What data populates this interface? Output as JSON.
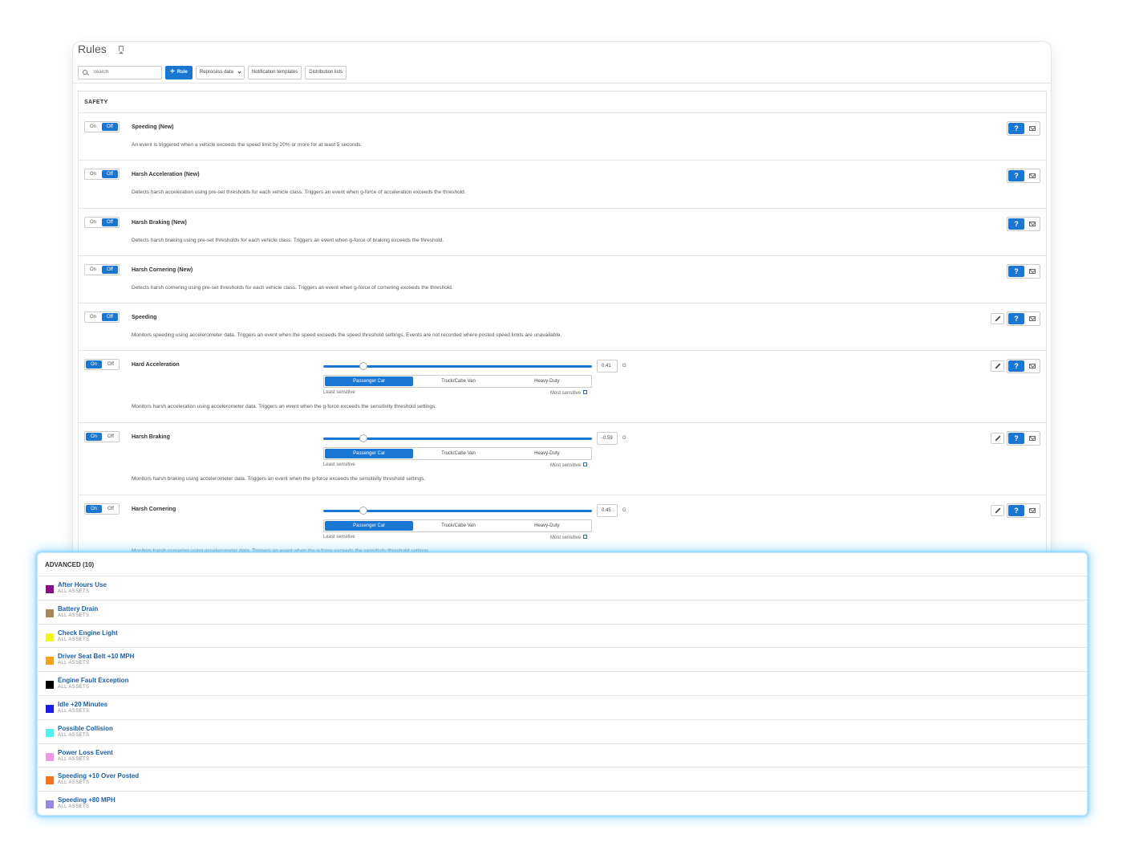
{
  "header": {
    "title": "Rules"
  },
  "toolbar": {
    "search_placeholder": "Search",
    "add_rule_label": "Rule",
    "reprocess_label": "Reprocess data",
    "notification_templates_label": "Notification templates",
    "distribution_lists_label": "Distribution lists"
  },
  "safety": {
    "title": "SAFETY",
    "on_label": "On",
    "off_label": "Off",
    "unit": "G",
    "vehicle_classes": [
      "Passenger Car",
      "Truck/Cabe Van",
      "Heavy-Duty"
    ],
    "least_sensitive": "Least sensitive",
    "most_sensitive": "Most sensitive",
    "rules": [
      {
        "name": "Speeding (New)",
        "description": "An event is triggered when a vehicle exceeds the speed limit by 20% or more for at least 5 seconds.",
        "state": "off",
        "editable": false
      },
      {
        "name": "Harsh Acceleration (New)",
        "description": "Detects harsh acceleration using pre-set thresholds for each vehicle class. Triggers an event when g-force of acceleration exceeds the threshold.",
        "state": "off",
        "editable": false
      },
      {
        "name": "Harsh Braking (New)",
        "description": "Detects harsh braking using pre-set thresholds for each vehicle class. Triggers an event when g-force of braking exceeds the threshold.",
        "state": "off",
        "editable": false
      },
      {
        "name": "Harsh Cornering (New)",
        "description": "Detects harsh cornering using pre-set thresholds for each vehicle class. Triggers an event when g-force of cornering exceeds the threshold.",
        "state": "off",
        "editable": false
      },
      {
        "name": "Speeding",
        "description": "Monitors speeding using accelerometer data. Triggers an event when the speed exceeds the speed threshold settings. Events are not recorded where posted speed limits are unavailable.",
        "state": "off",
        "editable": true
      },
      {
        "name": "Hard Acceleration",
        "description": "Monitors harsh acceleration using accelerometer data. Triggers an event when the g-force exceeds the sensitivity threshold settings.",
        "state": "on",
        "editable": true,
        "threshold": "0.41",
        "selected_class": "Passenger Car"
      },
      {
        "name": "Harsh Braking",
        "description": "Monitors harsh braking using accelerometer data. Triggers an event when the g-force exceeds the sensitivity threshold settings.",
        "state": "on",
        "editable": true,
        "threshold": "-0.59",
        "selected_class": "Passenger Car"
      },
      {
        "name": "Harsh Cornering",
        "description": "Monitors harsh cornering using accelerometer data. Triggers an event when the g-force exceeds the sensitivity threshold settings.",
        "state": "on",
        "editable": true,
        "threshold": "0.45",
        "selected_class": "Passenger Car"
      }
    ]
  },
  "advanced": {
    "title": "ADVANCED (10)",
    "items": [
      {
        "name": "After Hours Use",
        "scope": "ALL ASSETS",
        "color": "#8b0a8b"
      },
      {
        "name": "Battery Drain",
        "scope": "ALL ASSETS",
        "color": "#a8875a"
      },
      {
        "name": "Check Engine Light",
        "scope": "ALL ASSETS",
        "color": "#f5f51a"
      },
      {
        "name": "Driver Seat Belt +10 MPH",
        "scope": "ALL ASSETS",
        "color": "#f5a01a"
      },
      {
        "name": "Engine Fault Exception",
        "scope": "ALL ASSETS",
        "color": "#000000"
      },
      {
        "name": "Idle +20 Minutes",
        "scope": "ALL ASSETS",
        "color": "#1a1af0"
      },
      {
        "name": "Possible Collision",
        "scope": "ALL ASSETS",
        "color": "#4ef0f0"
      },
      {
        "name": "Power Loss Event",
        "scope": "ALL ASSETS",
        "color": "#f596e0"
      },
      {
        "name": "Speeding +10 Over Posted",
        "scope": "ALL ASSETS",
        "color": "#f5731a"
      },
      {
        "name": "Speeding +80 MPH",
        "scope": "ALL ASSETS",
        "color": "#9a86e6"
      }
    ]
  },
  "colors": {
    "accent": "#1976d2",
    "link": "#1a5fa8",
    "glow": "#8fd5ff"
  }
}
